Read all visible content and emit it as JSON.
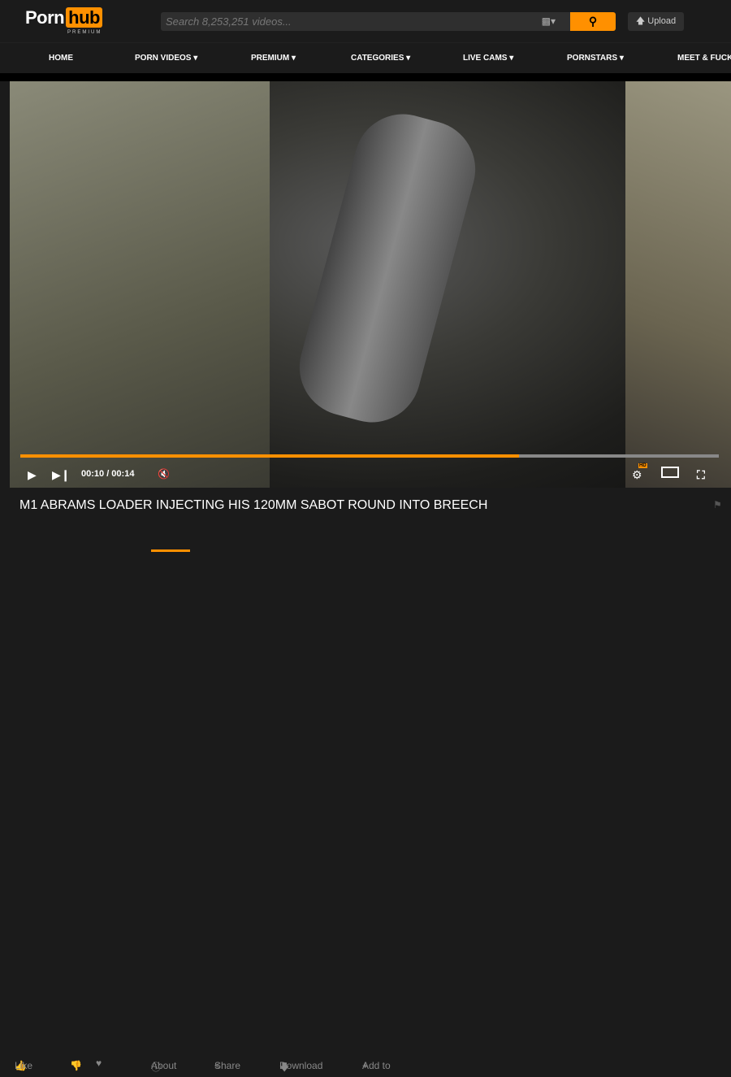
{
  "header": {
    "logo_porn": "Porn",
    "logo_hub": "hub",
    "logo_sub": "PREMIUM",
    "search_placeholder": "Search 8,253,251 videos...",
    "upload_label": "Upload"
  },
  "nav": [
    "HOME",
    "PORN VIDEOS",
    "PREMIUM",
    "CATEGORIES",
    "LIVE CAMS",
    "PORNSTARS",
    "MEET & FUCK"
  ],
  "player": {
    "current_time": "00:10",
    "duration": "00:14",
    "time_display": "00:10 / 00:14",
    "progress": 0.714,
    "hd_badge": "HD",
    "accent": "#ff9000"
  },
  "video": {
    "title": "M1 ABRAMS LOADER INJECTING HIS 120MM SABOT ROUND INTO BREECH"
  },
  "actions": {
    "like": "Like",
    "about": "About",
    "share": "Share",
    "download": "Download",
    "add_to": "Add to"
  }
}
